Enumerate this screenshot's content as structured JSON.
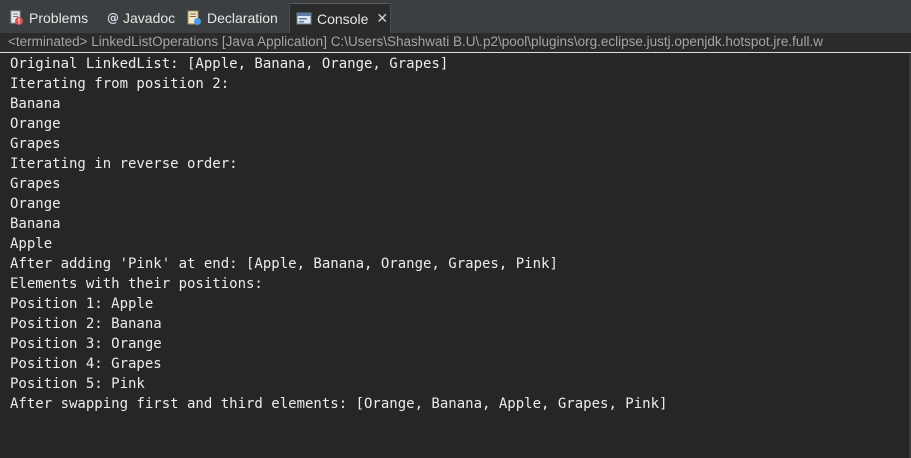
{
  "tabs": [
    {
      "label": "Problems",
      "icon": "problems-icon",
      "active": false
    },
    {
      "label": "Javadoc",
      "icon": "javadoc-icon",
      "active": false
    },
    {
      "label": "Declaration",
      "icon": "declaration-icon",
      "active": false
    },
    {
      "label": "Console",
      "icon": "console-icon",
      "active": true,
      "close_glyph": "✕"
    }
  ],
  "status": {
    "text": "<terminated> LinkedListOperations [Java Application] C:\\Users\\Shashwati B.U\\.p2\\pool\\plugins\\org.eclipse.justj.openjdk.hotspot.jre.full.w"
  },
  "console": {
    "lines": [
      "Original LinkedList: [Apple, Banana, Orange, Grapes]",
      "Iterating from position 2:",
      "Banana",
      "Orange",
      "Grapes",
      "Iterating in reverse order:",
      "Grapes",
      "Orange",
      "Banana",
      "Apple",
      "After adding 'Pink' at end: [Apple, Banana, Orange, Grapes, Pink]",
      "Elements with their positions:",
      "Position 1: Apple",
      "Position 2: Banana",
      "Position 3: Orange",
      "Position 4: Grapes",
      "Position 5: Pink",
      "After swapping first and third elements: [Orange, Banana, Apple, Grapes, Pink]"
    ]
  },
  "colors": {
    "background": "#2b2b2b",
    "tabbar": "#3c3f41",
    "text": "#ececec",
    "status_text": "#a5a5a5"
  }
}
